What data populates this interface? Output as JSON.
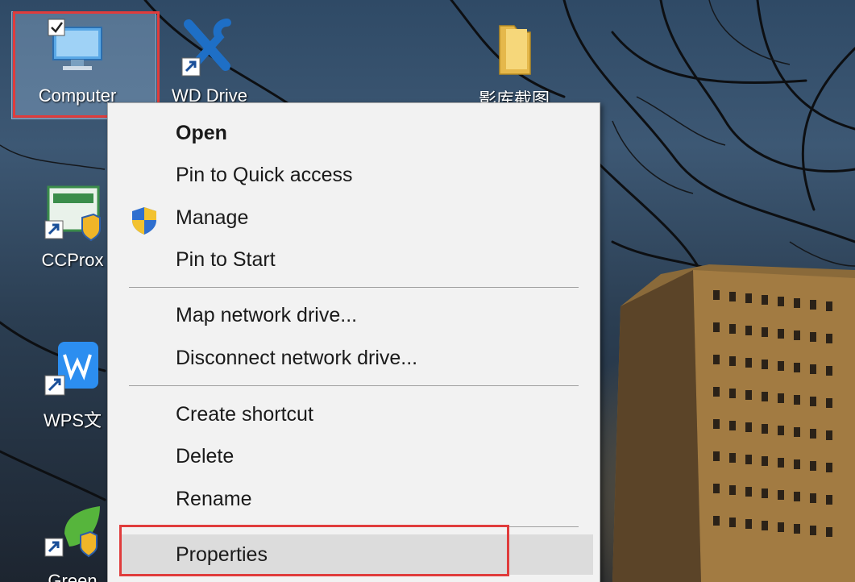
{
  "desktop": {
    "icons": [
      {
        "label": "Computer",
        "icon": "computer-icon"
      },
      {
        "label": "WD Drive",
        "icon": "tools-icon"
      },
      {
        "label": "影库截图",
        "icon": "folder-icon"
      },
      {
        "label": "CCProx",
        "icon": "ccproxy-icon"
      },
      {
        "label": "WPS文",
        "icon": "wps-icon"
      },
      {
        "label": "Green",
        "icon": "green-app-icon"
      }
    ]
  },
  "context_menu": {
    "items": [
      {
        "label": "Open",
        "bold": true
      },
      {
        "label": "Pin to Quick access"
      },
      {
        "label": "Manage",
        "icon": "uac-shield-icon"
      },
      {
        "label": "Pin to Start"
      },
      {
        "label": "Map network drive..."
      },
      {
        "label": "Disconnect network drive..."
      },
      {
        "label": "Create shortcut"
      },
      {
        "label": "Delete"
      },
      {
        "label": "Rename"
      },
      {
        "label": "Properties",
        "highlighted": true
      }
    ]
  },
  "colors": {
    "highlight_box": "#e03c3c",
    "menu_background": "#f2f2f2",
    "menu_hover": "#dcdcdc"
  }
}
